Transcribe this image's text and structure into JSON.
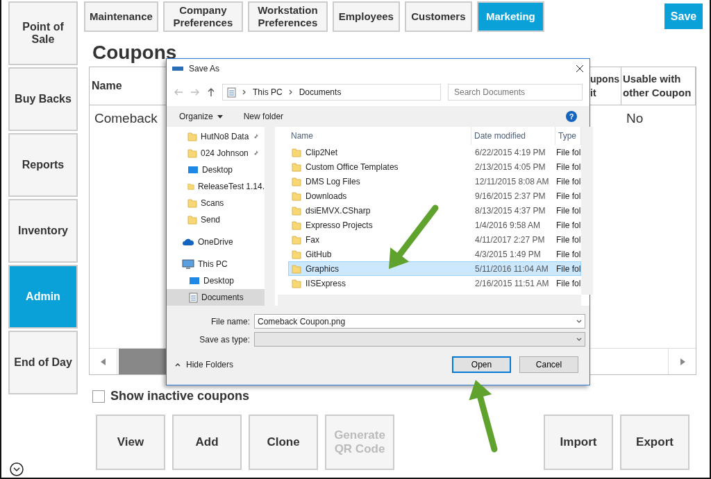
{
  "sidebar": {
    "items": [
      {
        "label": "Point of Sale",
        "selected": false
      },
      {
        "label": "Buy Backs",
        "selected": false
      },
      {
        "label": "Reports",
        "selected": false
      },
      {
        "label": "Inventory",
        "selected": false
      },
      {
        "label": "Admin",
        "selected": true
      },
      {
        "label": "End of Day",
        "selected": false
      }
    ]
  },
  "tabs": [
    {
      "label": "Maintenance",
      "selected": false
    },
    {
      "label": "Company Preferences",
      "selected": false
    },
    {
      "label": "Workstation Preferences",
      "selected": false
    },
    {
      "label": "Employees",
      "selected": false
    },
    {
      "label": "Customers",
      "selected": false
    },
    {
      "label": "Marketing",
      "selected": true
    }
  ],
  "save_button": "Save",
  "page_title": "Coupons",
  "table": {
    "columns": [
      "Name",
      "upons it",
      "Usable with other Coupon"
    ],
    "rows": [
      [
        "Comeback",
        "",
        "No"
      ]
    ]
  },
  "show_inactive": {
    "label": "Show inactive coupons",
    "checked": false
  },
  "buttons": [
    {
      "label": "View",
      "disabled": false
    },
    {
      "label": "Add",
      "disabled": false
    },
    {
      "label": "Clone",
      "disabled": false
    },
    {
      "label": "Generate QR Code",
      "disabled": true
    },
    {
      "label": "Import",
      "disabled": false
    },
    {
      "label": "Export",
      "disabled": false
    }
  ],
  "dialog": {
    "title": "Save As",
    "path": [
      "This PC",
      "Documents"
    ],
    "search": {
      "placeholder": "Search Documents"
    },
    "organize": "Organize",
    "new_folder": "New folder",
    "help": "?",
    "quick_access": [
      {
        "label": "HutNo8 Data",
        "kind": "folder",
        "pinned": true
      },
      {
        "label": "024 Johnson",
        "kind": "folder",
        "pinned": true
      },
      {
        "label": "Desktop",
        "kind": "desktop",
        "pinned": false
      },
      {
        "label": "ReleaseTest 1.14.",
        "kind": "folder",
        "pinned": false
      },
      {
        "label": "Scans",
        "kind": "folder",
        "pinned": false
      },
      {
        "label": "Send",
        "kind": "folder",
        "pinned": false
      }
    ],
    "locations": [
      {
        "label": "OneDrive",
        "kind": "cloud",
        "selected": false
      },
      {
        "label": "This PC",
        "kind": "pc",
        "selected": false,
        "children": [
          {
            "label": "Desktop",
            "kind": "desktop",
            "selected": false
          },
          {
            "label": "Documents",
            "kind": "document",
            "selected": true
          }
        ]
      }
    ],
    "columns": [
      "Name",
      "Date modified",
      "Type"
    ],
    "files": [
      {
        "name": "Clip2Net",
        "date": "6/22/2015 4:19 PM",
        "type": "File fol",
        "selected": false
      },
      {
        "name": "Custom Office Templates",
        "date": "2/13/2015 4:05 PM",
        "type": "File fol",
        "selected": false
      },
      {
        "name": "DMS Log Files",
        "date": "12/11/2015 8:08 AM",
        "type": "File fol",
        "selected": false
      },
      {
        "name": "Downloads",
        "date": "9/16/2015 2:37 PM",
        "type": "File fol",
        "selected": false
      },
      {
        "name": "dsiEMVX.CSharp",
        "date": "8/13/2015 4:37 PM",
        "type": "File fol",
        "selected": false
      },
      {
        "name": "Expresso Projects",
        "date": "1/4/2016 9:58 AM",
        "type": "File fol",
        "selected": false
      },
      {
        "name": "Fax",
        "date": "4/11/2017 2:27 PM",
        "type": "File fol",
        "selected": false
      },
      {
        "name": "GitHub",
        "date": "4/3/2015 1:49 PM",
        "type": "File fol",
        "selected": false
      },
      {
        "name": "Graphics",
        "date": "5/11/2016 11:04 AM",
        "type": "File fol",
        "selected": true
      },
      {
        "name": "IISExpress",
        "date": "2/16/2015 11:51 AM",
        "type": "File fol",
        "selected": false
      }
    ],
    "file_name_label": "File name:",
    "file_name": "Comeback Coupon.png",
    "type_label": "Save as type:",
    "hide_folders": "Hide Folders",
    "open": "Open",
    "cancel": "Cancel"
  }
}
